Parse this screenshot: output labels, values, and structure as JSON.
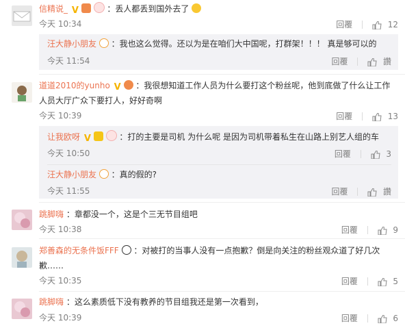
{
  "comments": [
    {
      "name": "信精说_",
      "text": "：丢人都丢到国外去了",
      "time": "今天 10:34",
      "reply_label": "回覆",
      "likes": "12",
      "replies": [
        {
          "name": "汪大静小朋友",
          "text": "：我也这么觉得。还以为是在咱们大中国呢，打群架！！！ 真是够可以的",
          "time": "今天 11:54",
          "reply_label": "回覆",
          "likes": "讚"
        }
      ]
    },
    {
      "name": "道道2010的yunho",
      "text": "：我很想知道工作人员为什么要打这个粉丝呢，他到底做了什么让工作人员大厅广众下要打人，好好奇啊",
      "time": "今天 10:39",
      "reply_label": "回覆",
      "likes": "13",
      "replies": [
        {
          "name": "让我欧呀",
          "text": "：打的主要是司机 为什么呢 是因为司机带着私生在山路上别艺人组的车",
          "time": "今天 10:50",
          "reply_label": "回覆",
          "likes": "3"
        },
        {
          "name": "汪大静小朋友",
          "text": "：真的假的?",
          "time": "今天 11:55",
          "reply_label": "回覆",
          "likes": "讚"
        }
      ]
    },
    {
      "name": "跳脚嗨",
      "text": "：章都没一个，这是个三无节目组吧",
      "time": "今天 10:38",
      "reply_label": "回覆",
      "likes": "9",
      "replies": []
    },
    {
      "name": "郑善森的无条件饭FFF",
      "text": "：对被打的当事人没有一点抱歉？倒是向关注的粉丝观众道了好几次歉……",
      "time": "今天 10:35",
      "reply_label": "回覆",
      "likes": "5",
      "replies": []
    },
    {
      "name": "跳脚嗨",
      "text": "：这么素质低下没有教养的节目组我还是第一次看到，",
      "time": "今天 10:39",
      "reply_label": "回覆",
      "likes": "6",
      "replies": []
    }
  ],
  "colors": {
    "name": "#eb7350",
    "meta": "#808080",
    "sub_bg": "#f2f2f5"
  }
}
